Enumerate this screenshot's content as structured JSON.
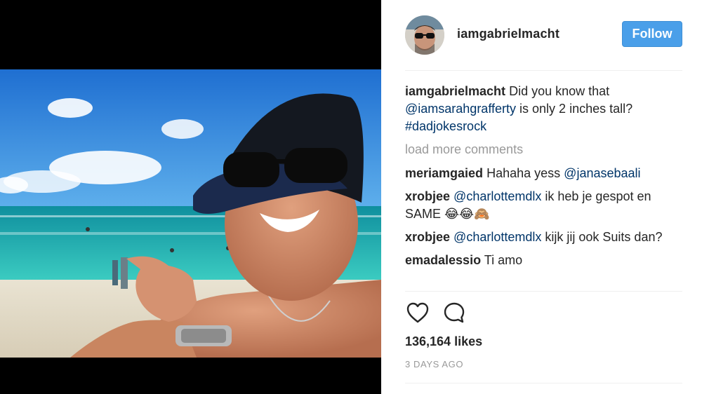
{
  "post": {
    "author": "iamgabrielmacht",
    "follow_label": "Follow",
    "caption": {
      "user": "iamgabrielmacht",
      "text_1": "Did you know that",
      "mention": "@iamsarahgrafferty",
      "text_2": "is only 2 inches tall?",
      "hashtag": "#dadjokesrock"
    },
    "load_more_label": "load more comments",
    "comments": [
      {
        "user": "meriamgaied",
        "text_before": "Hahaha yess",
        "mention": "@janasebaali",
        "text_after": ""
      },
      {
        "user": "xrobjee",
        "text_before": "",
        "mention": "@charlottemdlx",
        "text_after": "ik heb je gespot en SAME 😂😂🙈"
      },
      {
        "user": "xrobjee",
        "text_before": "",
        "mention": "@charlottemdlx",
        "text_after": "kijk jij ook Suits dan?"
      },
      {
        "user": "emadalessio",
        "text_before": "Ti amo",
        "mention": "",
        "text_after": ""
      }
    ],
    "likes": "136,164 likes",
    "timestamp": "3 DAYS AGO"
  },
  "icons": {
    "like": "heart-icon",
    "comment": "comment-bubble-icon"
  },
  "colors": {
    "follow_button": "#4a9fe9",
    "link": "#003569",
    "muted": "#999999",
    "text": "#262626"
  }
}
